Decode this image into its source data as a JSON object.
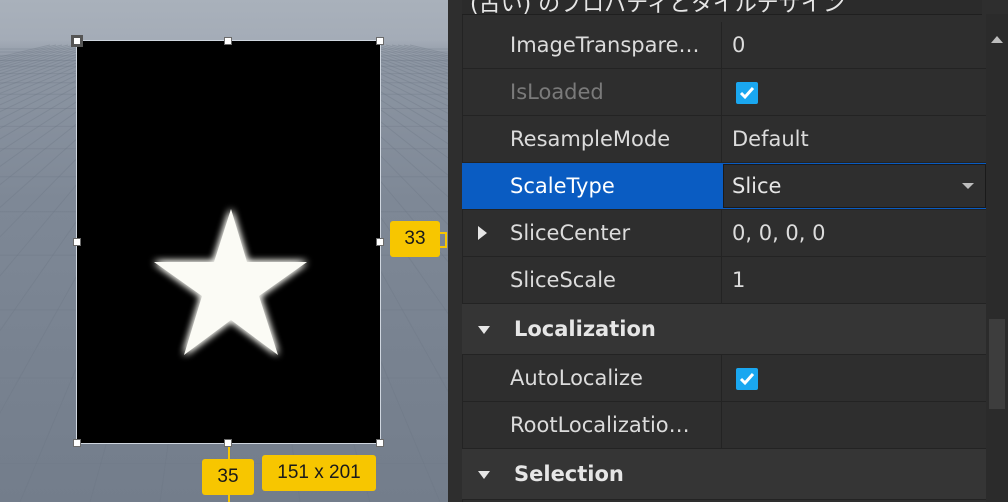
{
  "viewport": {
    "right_offset": "33",
    "bottom_offset": "35",
    "size": "151 x 201"
  },
  "panel": {
    "header_text": "(古い) のプロパティとタイルデザイン",
    "rows": [
      {
        "name": "ImageTranspare…",
        "value": "0"
      },
      {
        "name": "IsLoaded",
        "checked": true
      },
      {
        "name": "ResampleMode",
        "value": "Default"
      },
      {
        "name": "ScaleType",
        "value": "Slice"
      },
      {
        "name": "SliceCenter",
        "value": "0, 0, 0, 0"
      },
      {
        "name": "SliceScale",
        "value": "1"
      }
    ],
    "sections": {
      "localization": "Localization",
      "selection": "Selection"
    },
    "localization_rows": [
      {
        "name": "AutoLocalize",
        "checked": true
      },
      {
        "name": "RootLocalizatio…",
        "value": ""
      }
    ]
  },
  "colors": {
    "selection_accent": "#0a5cc2",
    "checkbox": "#1aa7f0",
    "measure_tag": "#f7c600"
  },
  "icons": {
    "expand": "triangle-right-icon",
    "collapse": "triangle-down-icon",
    "check": "check-icon",
    "dropdown": "chevron-down-icon"
  }
}
